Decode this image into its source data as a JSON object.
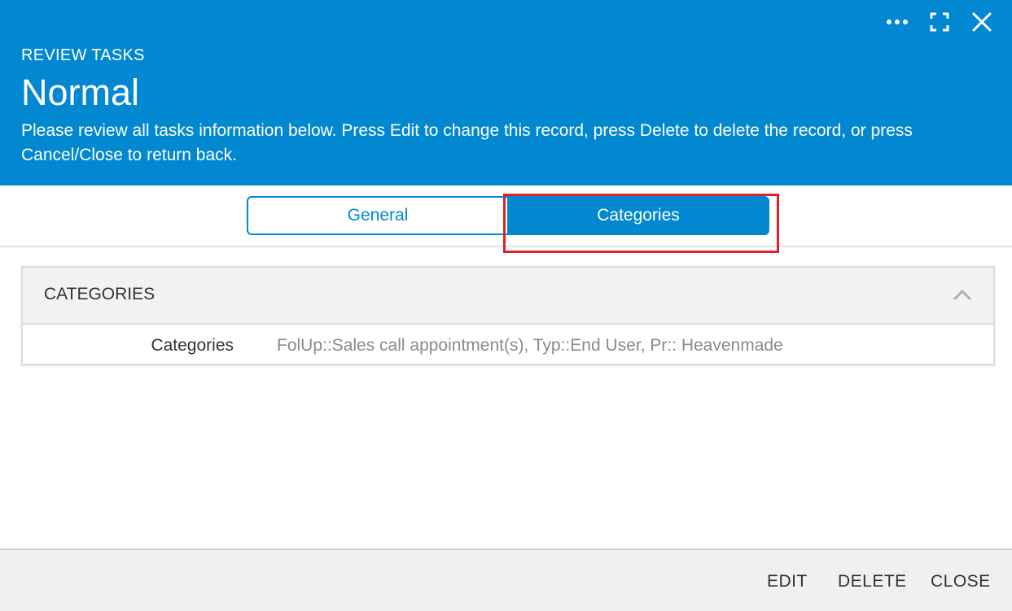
{
  "header": {
    "kicker": "REVIEW TASKS",
    "title": "Normal",
    "description": "Please review all tasks information below. Press Edit to change this record, press Delete to delete the record, or press Cancel/Close to return back.",
    "icons": [
      "more-icon",
      "fullscreen-icon",
      "close-icon"
    ],
    "background_color": "#0288d1"
  },
  "tabs": [
    {
      "label": "General",
      "selected": false
    },
    {
      "label": "Categories",
      "selected": true
    }
  ],
  "highlight_color": "#e0202a",
  "panel": {
    "title": "CATEGORIES",
    "expanded": true,
    "rows": [
      {
        "label": "Categories",
        "value": "FolUp::Sales call appointment(s), Typ::End User, Pr:: Heavenmade"
      }
    ]
  },
  "footer": {
    "edit_label": "EDIT",
    "delete_label": "DELETE",
    "close_label": "CLOSE"
  }
}
